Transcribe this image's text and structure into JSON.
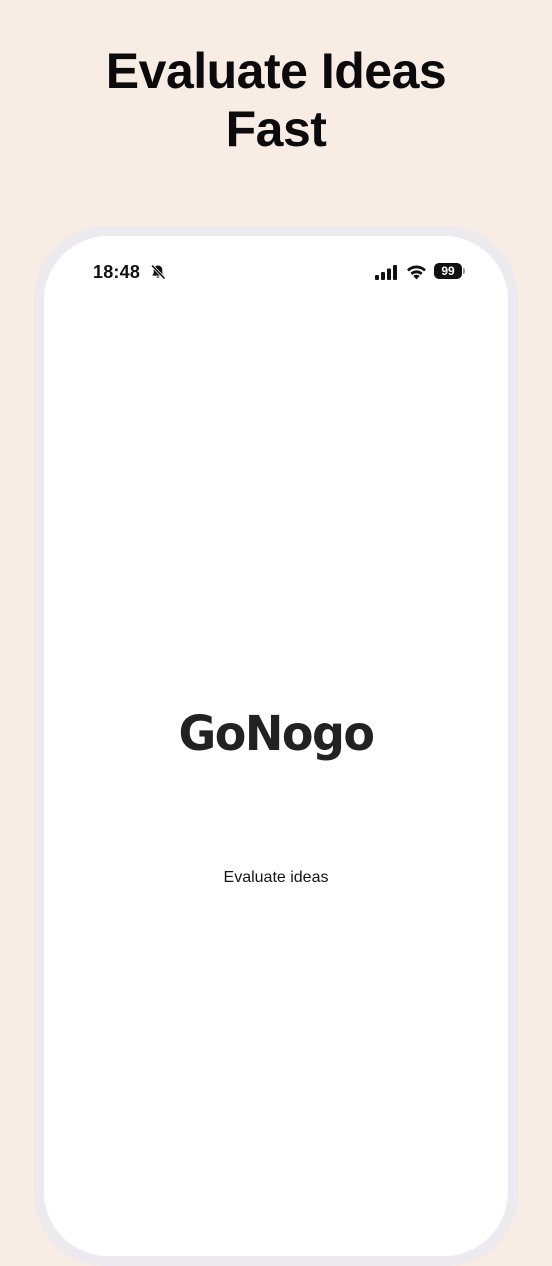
{
  "headline": {
    "line1": "Evaluate Ideas",
    "line2": "Fast"
  },
  "status_bar": {
    "time": "18:48",
    "battery_level": "99",
    "icons": [
      "bell-slash-icon",
      "cellular-signal-icon",
      "wifi-icon",
      "battery-icon"
    ]
  },
  "splash": {
    "logo_text": "GoNogo",
    "tagline": "Evaluate ideas"
  },
  "colors": {
    "background": "#f7ede4",
    "frame": "#eceaee",
    "screen": "#ffffff",
    "logo": "#222222"
  }
}
